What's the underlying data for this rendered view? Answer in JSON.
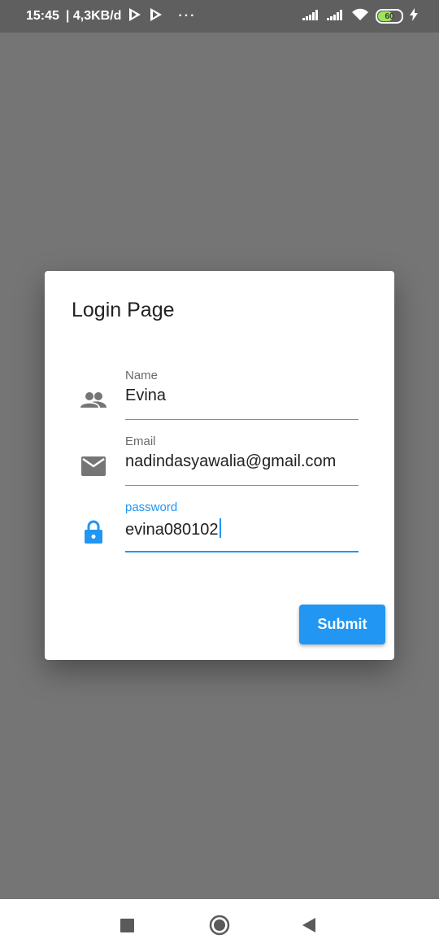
{
  "status_bar": {
    "time": "15:45",
    "speed": "| 4,3KB/d",
    "more": "···",
    "battery_level": "60"
  },
  "dialog": {
    "title": "Login Page",
    "fields": [
      {
        "label": "Name",
        "value": "Evina",
        "icon": "people-icon"
      },
      {
        "label": "Email",
        "value": "nadindasyawalia@gmail.com",
        "icon": "mail-icon"
      },
      {
        "label": "password",
        "value": "evina080102",
        "icon": "lock-icon"
      }
    ],
    "submit_label": "Submit"
  },
  "colors": {
    "accent": "#2196f3",
    "scrim": "#757575",
    "icon_gray": "#757575"
  }
}
